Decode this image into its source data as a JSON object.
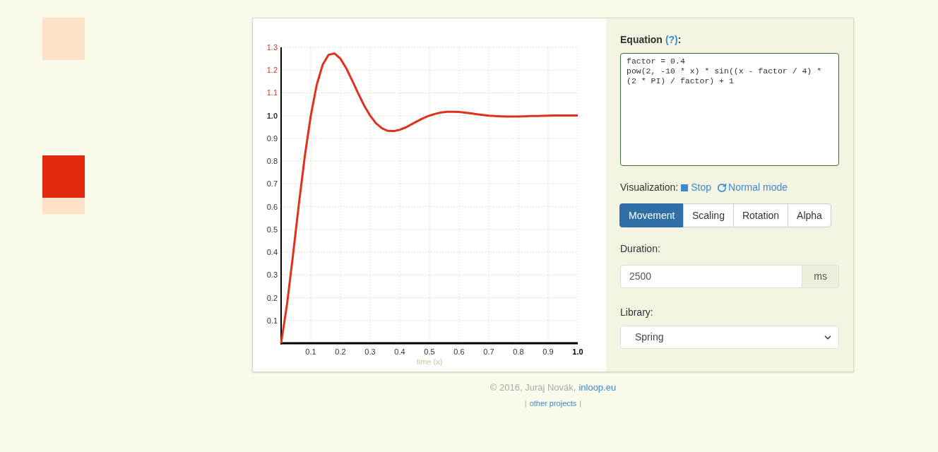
{
  "chart": {
    "chart_data": {
      "type": "line",
      "xlabel": "time (x)",
      "x": [
        0,
        0.02,
        0.04,
        0.06,
        0.08,
        0.1,
        0.12,
        0.14,
        0.16,
        0.18,
        0.2,
        0.22,
        0.24,
        0.26,
        0.28,
        0.3,
        0.32,
        0.34,
        0.36,
        0.38,
        0.4,
        0.42,
        0.44,
        0.46,
        0.48,
        0.5,
        0.52,
        0.54,
        0.56,
        0.58,
        0.6,
        0.62,
        0.64,
        0.66,
        0.68,
        0.7,
        0.72,
        0.74,
        0.76,
        0.78,
        0.8,
        0.82,
        0.84,
        0.86,
        0.88,
        0.9,
        0.92,
        0.94,
        0.96,
        0.98,
        1
      ],
      "values": [
        0,
        0.172,
        0.387,
        0.612,
        0.823,
        1,
        1.135,
        1.223,
        1.267,
        1.273,
        1.25,
        1.207,
        1.153,
        1.097,
        1.044,
        1,
        0.966,
        0.944,
        0.933,
        0.932,
        0.938,
        0.948,
        0.962,
        0.976,
        0.989,
        1,
        1.008,
        1.014,
        1.017,
        1.017,
        1.016,
        1.013,
        1.01,
        1.006,
        1.003,
        1,
        0.998,
        0.997,
        0.996,
        0.996,
        0.996,
        0.997,
        0.998,
        0.998,
        0.999,
        1,
        1.001,
        1.001,
        1.001,
        1.001,
        1.001
      ],
      "grid": true,
      "xlim": [
        0,
        1
      ],
      "ylim": [
        0,
        1.3
      ],
      "xticks": [
        {
          "value": 0.1,
          "label": "0.1"
        },
        {
          "value": 0.2,
          "label": "0.2"
        },
        {
          "value": 0.3,
          "label": "0.3"
        },
        {
          "value": 0.4,
          "label": "0.4"
        },
        {
          "value": 0.5,
          "label": "0.5"
        },
        {
          "value": 0.6,
          "label": "0.6"
        },
        {
          "value": 0.7,
          "label": "0.7"
        },
        {
          "value": 0.8,
          "label": "0.8"
        },
        {
          "value": 0.9,
          "label": "0.9"
        },
        {
          "value": 1,
          "label": "1.0"
        }
      ],
      "yticks": [
        {
          "value": 0.1,
          "label": "0.1"
        },
        {
          "value": 0.2,
          "label": "0.2"
        },
        {
          "value": 0.3,
          "label": "0.3"
        },
        {
          "value": 0.4,
          "label": "0.4"
        },
        {
          "value": 0.5,
          "label": "0.5"
        },
        {
          "value": 0.6,
          "label": "0.6"
        },
        {
          "value": 0.7,
          "label": "0.7"
        },
        {
          "value": 0.8,
          "label": "0.8"
        },
        {
          "value": 0.9,
          "label": "0.9"
        },
        {
          "value": 1,
          "label": "1.0"
        },
        {
          "value": 1.1,
          "label": "1.1"
        },
        {
          "value": 1.2,
          "label": "1.2"
        },
        {
          "value": 1.3,
          "label": "1.3"
        }
      ]
    }
  },
  "equation": {
    "label": "Equation",
    "help_link": "(?)",
    "colon": ":",
    "value": "factor = 0.4\npow(2, -10 * x) * sin((x - factor / 4) * (2 * PI) / factor) + 1"
  },
  "visualization": {
    "label": "Visualization:",
    "stop": "Stop",
    "mode": "Normal mode"
  },
  "tabs": [
    {
      "label": "Movement",
      "selected": true
    },
    {
      "label": "Scaling",
      "selected": false
    },
    {
      "label": "Rotation",
      "selected": false
    },
    {
      "label": "Alpha",
      "selected": false
    }
  ],
  "duration": {
    "label": "Duration:",
    "value": "2500",
    "unit": "ms"
  },
  "library": {
    "label": "Library:",
    "value": "Spring"
  },
  "footer": {
    "copyright": "© 2016, Juraj Novák,",
    "link": "inloop.eu",
    "bar_left": "|",
    "other": "other projects",
    "bar_right": "|"
  }
}
